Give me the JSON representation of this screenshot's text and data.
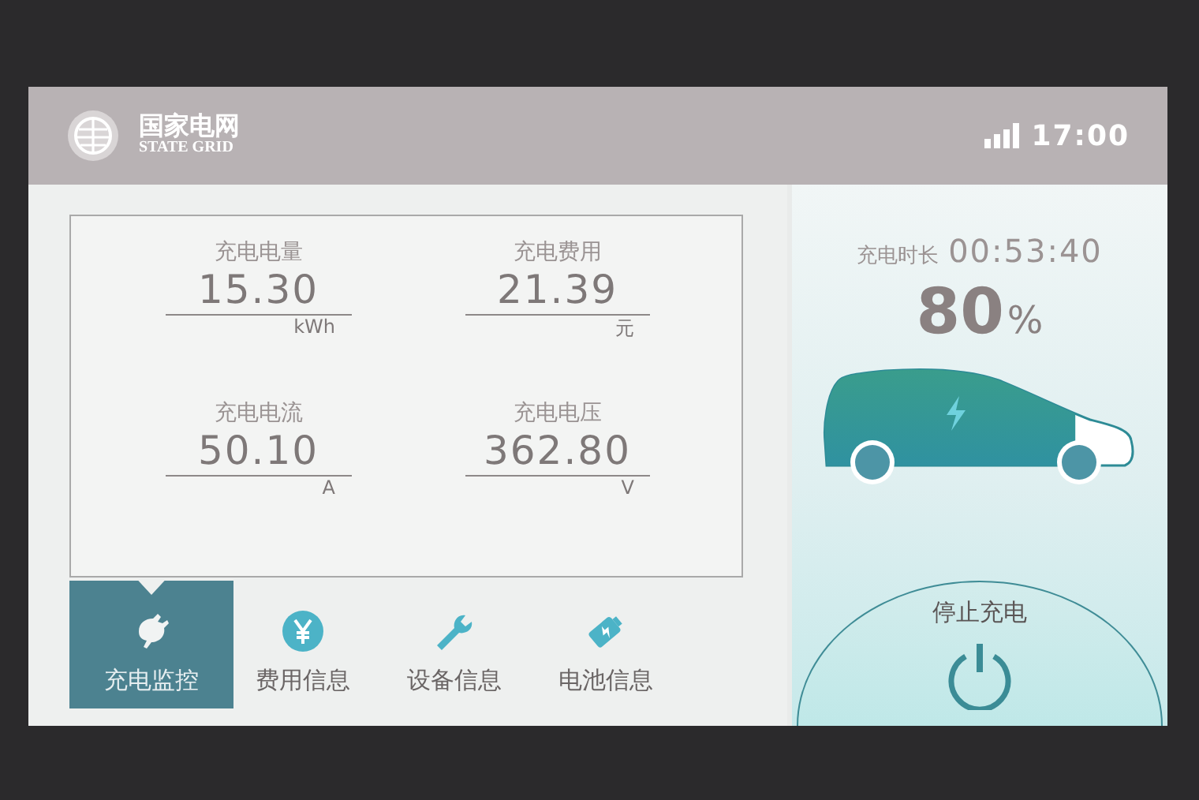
{
  "header": {
    "brand_cn": "国家电网",
    "brand_en": "STATE GRID",
    "time": "17:00"
  },
  "metrics": [
    {
      "label": "充电电量",
      "value": "15.30",
      "unit": "kWh"
    },
    {
      "label": "充电费用",
      "value": "21.39",
      "unit": "元"
    },
    {
      "label": "充电电流",
      "value": "50.10",
      "unit": "A"
    },
    {
      "label": "充电电压",
      "value": "362.80",
      "unit": "V"
    }
  ],
  "tabs": [
    {
      "label": "充电监控",
      "selected": true
    },
    {
      "label": "费用信息",
      "selected": false
    },
    {
      "label": "设备信息",
      "selected": false
    },
    {
      "label": "电池信息",
      "selected": false
    }
  ],
  "status": {
    "duration_label": "充电时长",
    "duration": "00:53:40",
    "percent": "80",
    "percent_sign": "%",
    "battery": {
      "level": 0.8
    }
  },
  "stop_button": {
    "label": "停止充电"
  }
}
